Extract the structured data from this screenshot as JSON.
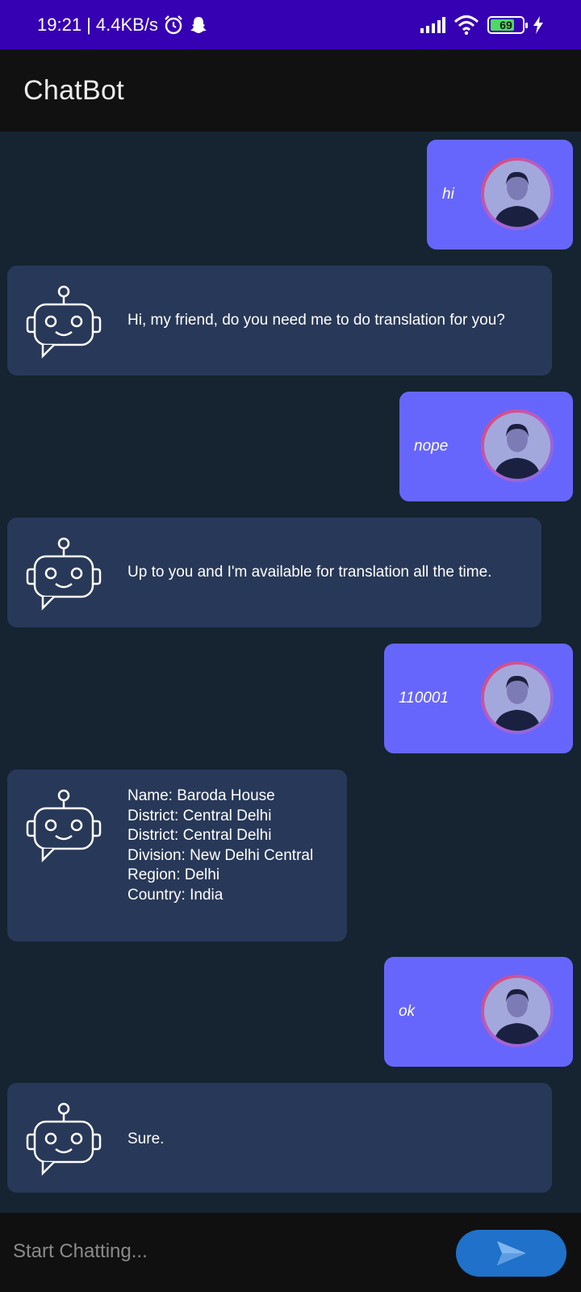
{
  "status_bar": {
    "time": "19:21",
    "speed": "| 4.4KB/s",
    "battery": "69",
    "icons": [
      "alarm-icon",
      "snapchat-icon",
      "signal-icon",
      "wifi-icon",
      "battery-icon",
      "charging-icon"
    ]
  },
  "app_bar": {
    "title": "ChatBot"
  },
  "messages": [
    {
      "sender": "user",
      "text": "hi"
    },
    {
      "sender": "bot",
      "text": "Hi, my friend, do you need me to do translation for you?"
    },
    {
      "sender": "user",
      "text": "nope"
    },
    {
      "sender": "bot",
      "text": "Up to you and I'm available for translation all the time."
    },
    {
      "sender": "user",
      "text": "110001"
    },
    {
      "sender": "bot",
      "text": "Name: Baroda House\nDistrict: Central Delhi\nDistrict: Central Delhi\nDivision: New Delhi Central\nRegion: Delhi\nCountry: India"
    },
    {
      "sender": "user",
      "text": "ok"
    },
    {
      "sender": "bot",
      "text": "Sure."
    }
  ],
  "input": {
    "placeholder": "Start Chatting...",
    "value": ""
  },
  "colors": {
    "status_bar": "#3600b3",
    "app_bar": "#111111",
    "chat_background": "#152430",
    "user_bubble": "#6766fc",
    "bot_bubble": "#283858",
    "send_button": "#1f71c9"
  }
}
